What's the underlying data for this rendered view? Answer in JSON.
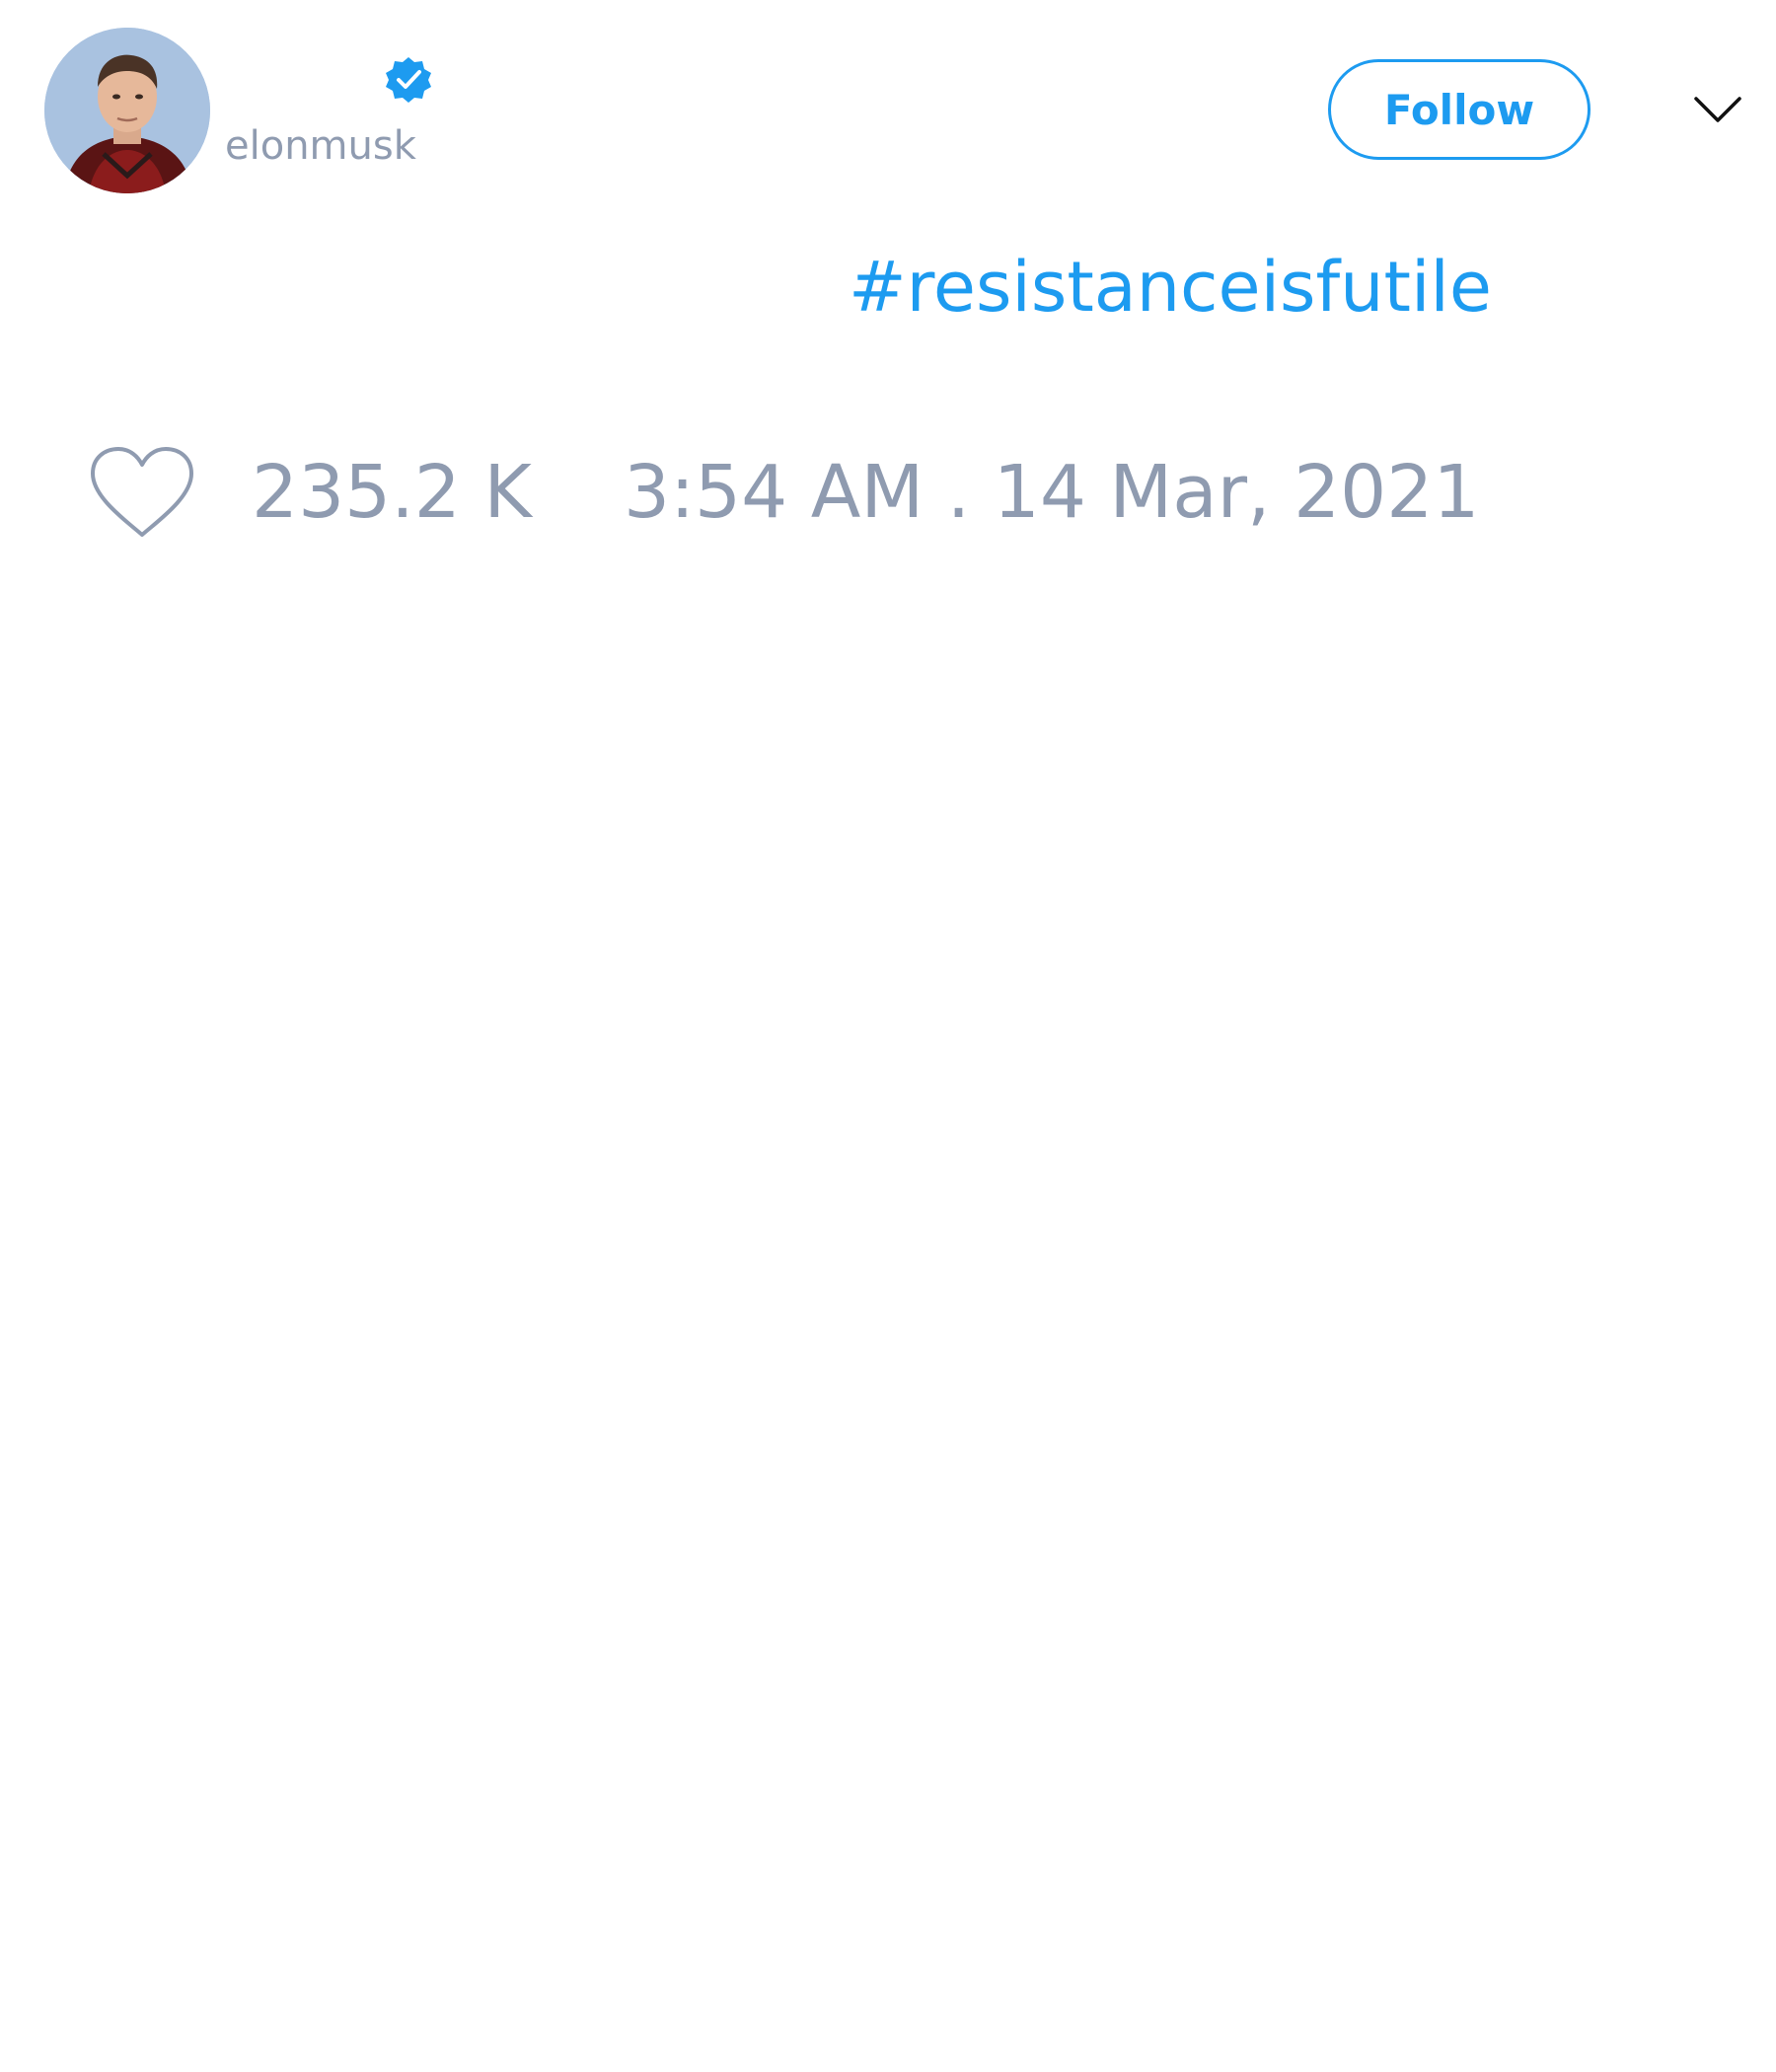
{
  "tweet": {
    "author": {
      "handle": "elonmusk",
      "verified": true,
      "avatar_icon": "profile-photo"
    },
    "follow_label": "Follow",
    "menu_icon": "chevron-down-icon",
    "text": "#resistanceisfutile",
    "likes": "235.2 K",
    "timestamp": "3:54 AM . 14 Mar, 2021"
  },
  "colors": {
    "accent": "#1d9bf0",
    "muted": "#8f9bb0",
    "background": "#ffffff"
  }
}
